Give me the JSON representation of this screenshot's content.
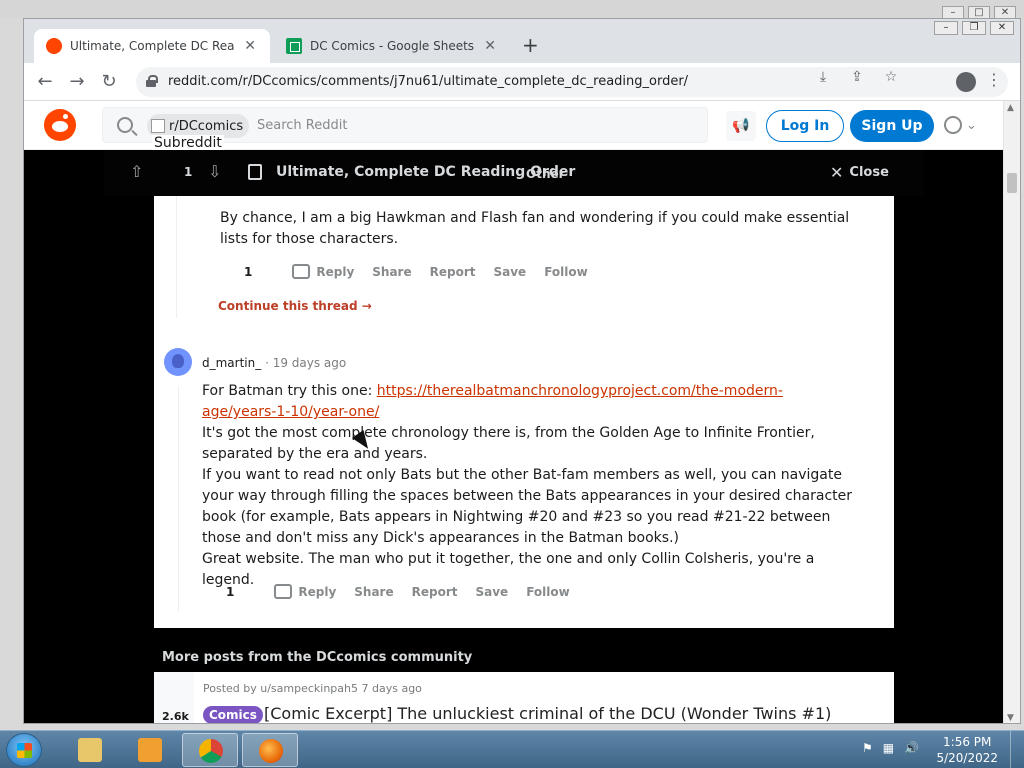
{
  "browser": {
    "tabs": [
      {
        "title": "Ultimate, Complete DC Reading",
        "close": "✕"
      },
      {
        "title": "DC Comics - Google Sheets",
        "close": "✕"
      }
    ],
    "new_tab": "+",
    "url": "reddit.com/r/DCcomics/comments/j7nu61/ultimate_complete_dc_reading_order/"
  },
  "reddit_header": {
    "subreddit_chip": "r/DCcomics",
    "search_placeholder": "Search Reddit",
    "subreddit_label": "Subreddit",
    "login": "Log In",
    "signup": "Sign Up"
  },
  "post_bar": {
    "upvote": "⇧",
    "downvote": "⇩",
    "score": "1",
    "title": "Ultimate, Complete DC Reading Order",
    "flair": "Other",
    "close": "Close"
  },
  "comment_1": {
    "body": "By chance, I am a big Hawkman and Flash fan and wondering if you could make essential lists for those characters.",
    "score": "1",
    "actions": [
      "Reply",
      "Share",
      "Report",
      "Save",
      "Follow"
    ],
    "continue_label": "Continue this thread"
  },
  "comment_2": {
    "author": "d_martin_",
    "timestamp": "· 19 days ago",
    "intro": "For Batman try this one: ",
    "link": "https://therealbatmanchronologyproject.com/the-modern-age/years-1-10/year-one/",
    "body": "It's got the most complete chronology there is, from the Golden Age to Infinite Frontier, separated by the era and years.\nIf you want to read not only Bats but the other Bat-fam members as well, you can navigate your way through filling the spaces between the Bats appearances in your desired character book (for example, Bats appears in Nightwing #20 and #23 so you read #21-22 between those and don't miss any Dick's appearances in the Batman books.)\nGreat website. The man who put it together, the one and only Collin Colsheris, you're a legend.",
    "score": "1",
    "actions": [
      "Reply",
      "Share",
      "Report",
      "Save",
      "Follow"
    ]
  },
  "more_posts": {
    "heading": "More posts from the DCcomics community",
    "post": {
      "byline": "Posted by u/sampeckinpah5 7 days ago",
      "score": "2.6k",
      "flair": "Comics",
      "title": "[Comic Excerpt] The unluckiest criminal of the DCU (Wonder Twins #1)"
    }
  },
  "taskbar": {
    "time": "1:56 PM",
    "date": "5/20/2022"
  },
  "colors": {
    "reddit_orange": "#ff4500",
    "reddit_blue": "#0079d3",
    "link_red": "#cc3300",
    "flair_purple": "#7b56c2"
  }
}
